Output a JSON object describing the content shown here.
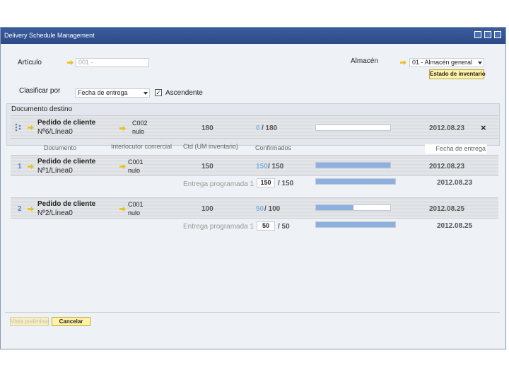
{
  "window": {
    "title": "Delivery Schedule Management"
  },
  "filters": {
    "articulo_label": "Artículo",
    "articulo_value": "001 -",
    "almacen_label": "Almacén",
    "almacen_value": "01 - Almacén general",
    "estado_button": "Estado de inventario",
    "clasificar_label": "Clasificar por",
    "clasificar_value": "Fecha de entrega",
    "ascendente_label": "Ascendente",
    "ascendente_checked": true
  },
  "target": {
    "section_label": "Documento destino",
    "doc_title": "Pedido de cliente",
    "doc_ref": "Nº6/Línea0",
    "partner_code": "C002",
    "partner_name": "nulo",
    "qty": "180",
    "confirmed": "0",
    "confirmed_total": "/ 180",
    "confirmed_fraction": 0.0,
    "date": "2012.08.23",
    "close_icon": "×"
  },
  "columns": {
    "documento": "Documento",
    "interlocutor": "Interlocutor comercial",
    "ctd": "Ctd (UM inventario)",
    "confirmados": "Confirmados",
    "fecha": "Fecha de entrega"
  },
  "rows": [
    {
      "index": "1",
      "doc_title": "Pedido de cliente",
      "doc_ref": "Nº1/Línea0",
      "partner_code": "C001",
      "partner_name": "nulo",
      "qty": "150",
      "confirmed": "150",
      "confirmed_total": "/ 150",
      "confirmed_fraction": 1.0,
      "date": "2012.08.23",
      "sub": {
        "label": "Entrega programada 1",
        "value": "150",
        "total": "/ 150",
        "fraction": 1.0,
        "date": "2012.08.23"
      }
    },
    {
      "index": "2",
      "doc_title": "Pedido de cliente",
      "doc_ref": "Nº2/Línea0",
      "partner_code": "C001",
      "partner_name": "nulo",
      "qty": "100",
      "confirmed": "50",
      "confirmed_total": "/ 100",
      "confirmed_fraction": 0.5,
      "date": "2012.08.25",
      "sub": {
        "label": "Entrega programada 1",
        "value": "50",
        "total": "/ 50",
        "fraction": 1.0,
        "date": "2012.08.25"
      }
    }
  ],
  "footer": {
    "preview_button": "Vista preliminar",
    "cancel_button": "Cancelar"
  },
  "colors": {
    "titlebar": "#2c4a86",
    "bar_fill": "#8db0e0",
    "button_yellow": "#fff3a8"
  }
}
